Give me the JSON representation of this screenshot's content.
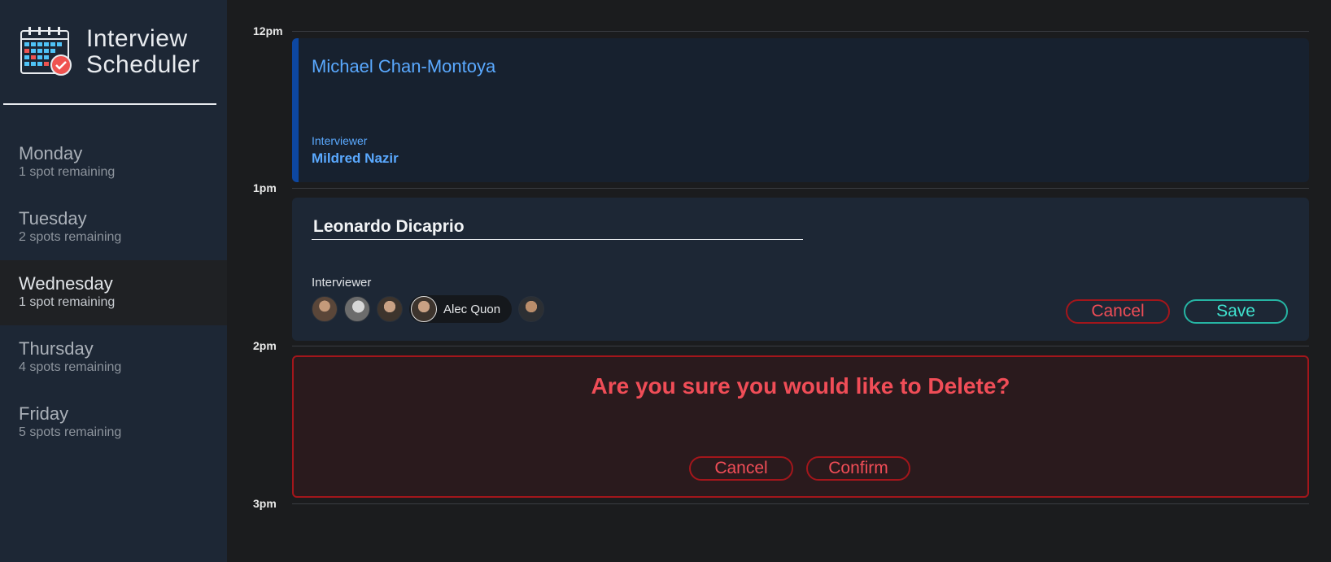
{
  "brand": {
    "title_line1": "Interview",
    "title_line2": "Scheduler"
  },
  "days": [
    {
      "name": "Monday",
      "spots": "1 spot remaining",
      "selected": false
    },
    {
      "name": "Tuesday",
      "spots": "2 spots remaining",
      "selected": false
    },
    {
      "name": "Wednesday",
      "spots": "1 spot remaining",
      "selected": true
    },
    {
      "name": "Thursday",
      "spots": "4 spots remaining",
      "selected": false
    },
    {
      "name": "Friday",
      "spots": "5 spots remaining",
      "selected": false
    }
  ],
  "times": [
    "12pm",
    "1pm",
    "2pm",
    "3pm"
  ],
  "appointment_show": {
    "student": "Michael Chan-Montoya",
    "interviewer_label": "Interviewer",
    "interviewer_name": "Mildred Nazir"
  },
  "appointment_form": {
    "student_value": "Leonardo Dicaprio",
    "interviewer_label": "Interviewer",
    "selected_interviewer": "Alec Quon",
    "cancel_label": "Cancel",
    "save_label": "Save"
  },
  "confirm": {
    "message": "Are you sure you would like to Delete?",
    "cancel_label": "Cancel",
    "confirm_label": "Confirm"
  },
  "colors": {
    "sidebar": "#1d2735",
    "accent_blue": "#5aa9ff",
    "danger": "#f04d57",
    "success": "#3fe3cf"
  }
}
